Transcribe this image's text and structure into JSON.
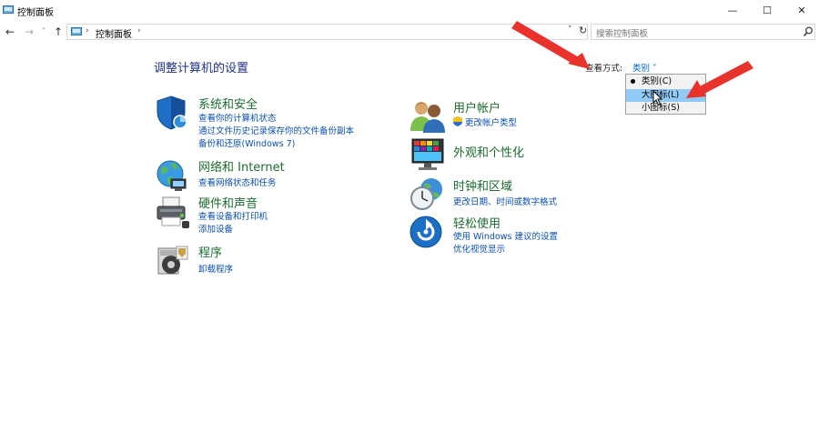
{
  "window": {
    "title": "控制面板",
    "controls": {
      "minimize": "—",
      "maximize": "☐",
      "close": "✕"
    }
  },
  "nav": {
    "back": "←",
    "forward": "→",
    "recent": "˅",
    "up": "↑",
    "breadcrumb_sep": "›",
    "breadcrumb": "控制面板",
    "address_dropdown": "˅",
    "refresh": "↻",
    "search_placeholder": "搜索控制面板"
  },
  "header": {
    "title": "调整计算机的设置",
    "view_by_label": "查看方式:",
    "view_by_value": "类别 ˅"
  },
  "view_menu": {
    "items": [
      "类别(C)",
      "大图标(L)",
      "小图标(S)"
    ],
    "selected_index": 0,
    "highlighted_index": 1
  },
  "categories": {
    "system": {
      "title": "系统和安全",
      "links": [
        "查看你的计算机状态",
        "通过文件历史记录保存你的文件备份副本",
        "备份和还原(Windows 7)"
      ]
    },
    "network": {
      "title": "网络和 Internet",
      "links": [
        "查看网络状态和任务"
      ]
    },
    "hardware": {
      "title": "硬件和声音",
      "links": [
        "查看设备和打印机",
        "添加设备"
      ]
    },
    "programs": {
      "title": "程序",
      "links": [
        "卸载程序"
      ]
    },
    "users": {
      "title": "用户帐户",
      "links": [
        "更改帐户类型"
      ]
    },
    "appearance": {
      "title": "外观和个性化",
      "links": []
    },
    "clock": {
      "title": "时钟和区域",
      "links": [
        "更改日期、时间或数字格式"
      ]
    },
    "ease": {
      "title": "轻松使用",
      "links": [
        "使用 Windows 建议的设置",
        "优化视觉显示"
      ]
    }
  },
  "colors": {
    "title_blue": "#1e3287",
    "category_green": "#1c6c2e",
    "link_blue": "#0a4fb3",
    "menu_highlight": "#91c9f7",
    "annotation_red": "#e8322b"
  }
}
